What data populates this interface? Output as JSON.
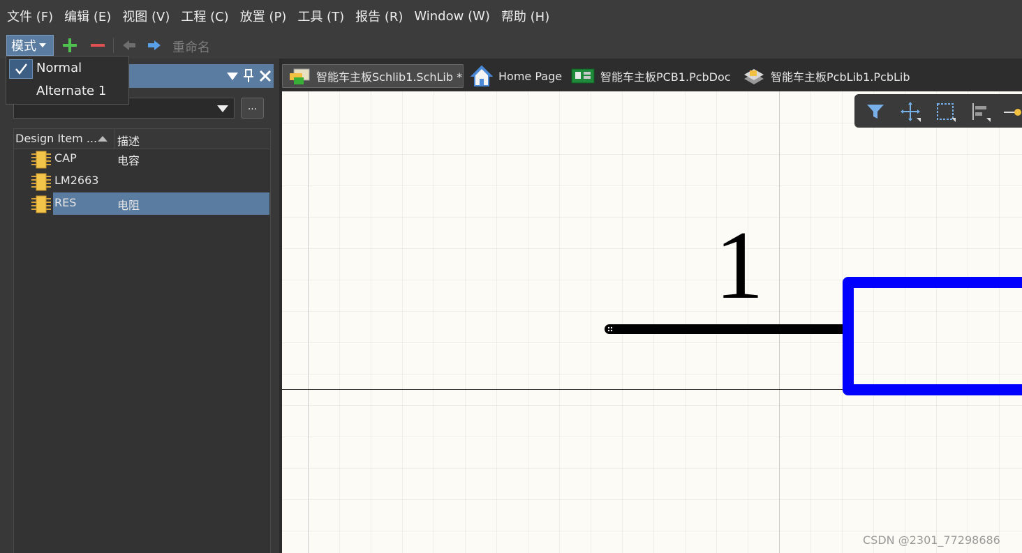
{
  "menubar": {
    "items": [
      "文件 (F)",
      "编辑 (E)",
      "视图 (V)",
      "工程 (C)",
      "放置 (P)",
      "工具 (T)",
      "报告 (R)",
      "Window (W)",
      "帮助 (H)"
    ]
  },
  "toolbar": {
    "mode_label": "模式",
    "rename_label": "重命名"
  },
  "mode_menu": {
    "items": [
      {
        "label": "Normal",
        "checked": true
      },
      {
        "label": "Alternate 1",
        "checked": false
      }
    ]
  },
  "panel": {
    "browse_label": "...",
    "columns": {
      "name": "Design Item ...",
      "desc": "描述"
    },
    "rows": [
      {
        "name": "CAP",
        "desc": "电容",
        "selected": false
      },
      {
        "name": "LM2663",
        "desc": "",
        "selected": false
      },
      {
        "name": "RES",
        "desc": "电阻",
        "selected": true
      }
    ]
  },
  "tabs": [
    {
      "label": "智能车主板Schlib1.SchLib *",
      "icon": "schlib-icon",
      "active": true
    },
    {
      "label": "Home Page",
      "icon": "home-icon",
      "active": false
    },
    {
      "label": "智能车主板PCB1.PcbDoc",
      "icon": "pcbdoc-icon",
      "active": false
    },
    {
      "label": "智能车主板PcbLib1.PcbLib",
      "icon": "pcblib-icon",
      "active": false
    }
  ],
  "canvas": {
    "pin_number": "1",
    "watermark": "CSDN @2301_77298686",
    "colors": {
      "body": "#0000ff",
      "background": "#fdfbf5",
      "pin": "#000000"
    }
  }
}
